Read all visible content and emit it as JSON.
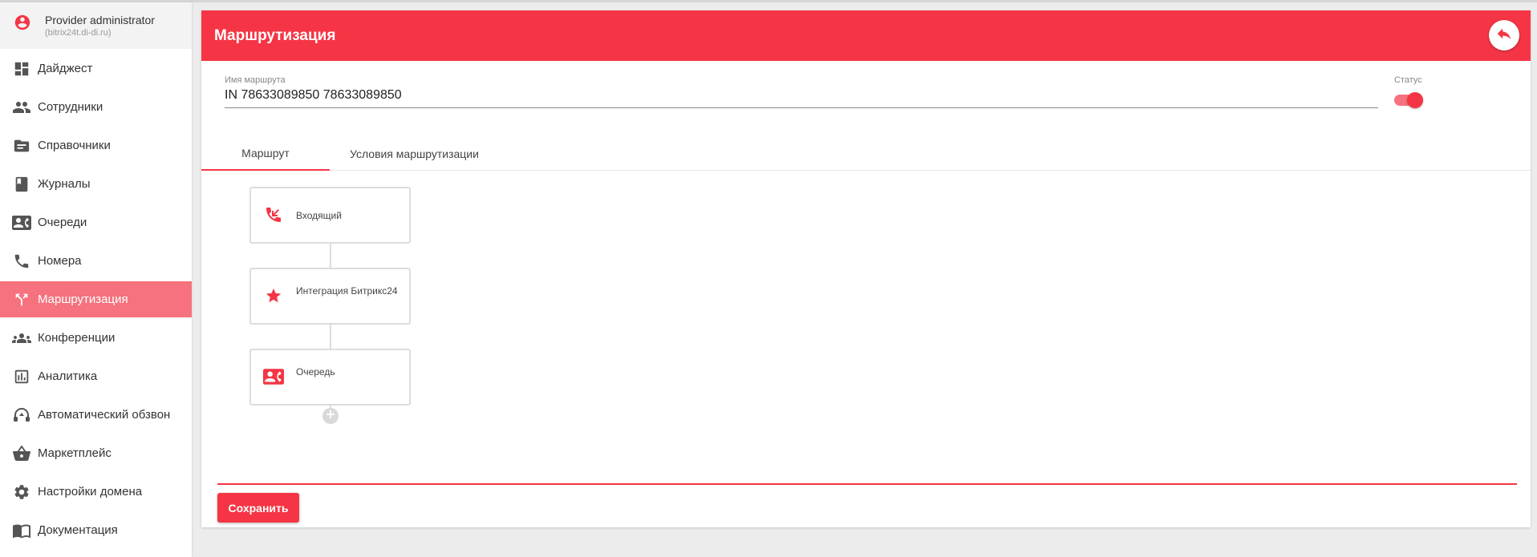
{
  "user": {
    "name": "Provider administrator",
    "domain": "(bitrix24t.di-di.ru)",
    "icon": "account-circle-icon"
  },
  "sidebar": {
    "items": [
      {
        "label": "Дайджест",
        "icon": "dashboard-icon",
        "active": false
      },
      {
        "label": "Сотрудники",
        "icon": "people-icon",
        "active": false
      },
      {
        "label": "Справочники",
        "icon": "folder-icon",
        "active": false
      },
      {
        "label": "Журналы",
        "icon": "book-icon",
        "active": false
      },
      {
        "label": "Очереди",
        "icon": "contact-phone-icon",
        "active": false
      },
      {
        "label": "Номера",
        "icon": "phone-icon",
        "active": false
      },
      {
        "label": "Маршрутизация",
        "icon": "route-split-icon",
        "active": true
      },
      {
        "label": "Конференции",
        "icon": "group-icon",
        "active": false
      },
      {
        "label": "Аналитика",
        "icon": "bar-chart-icon",
        "active": false
      },
      {
        "label": "Автоматический обзвон",
        "icon": "headset-icon",
        "active": false
      },
      {
        "label": "Маркетплейс",
        "icon": "basket-icon",
        "active": false
      },
      {
        "label": "Настройки домена",
        "icon": "gear-icon",
        "active": false
      },
      {
        "label": "Документация",
        "icon": "open-book-icon",
        "active": false
      }
    ]
  },
  "header": {
    "title": "Маршрутизация",
    "back_icon": "reply-icon"
  },
  "form": {
    "route_name_label": "Имя маршрута",
    "route_name_value": "IN 78633089850 78633089850",
    "status_label": "Статус",
    "status_on": true
  },
  "tabs": [
    {
      "label": "Маршрут",
      "active": true
    },
    {
      "label": "Условия маршрутизации",
      "active": false
    }
  ],
  "flow": {
    "nodes": [
      {
        "label": "Входящий",
        "icon": "incoming-call-icon"
      },
      {
        "label": "Интеграция Битрикс24",
        "icon": "star-icon"
      },
      {
        "label": "Очередь",
        "icon": "contact-phone-icon"
      }
    ],
    "add_icon": "plus-icon"
  },
  "footer": {
    "save_label": "Сохранить"
  },
  "colors": {
    "accent": "#f53545",
    "sidebar_active": "#f5727e"
  }
}
